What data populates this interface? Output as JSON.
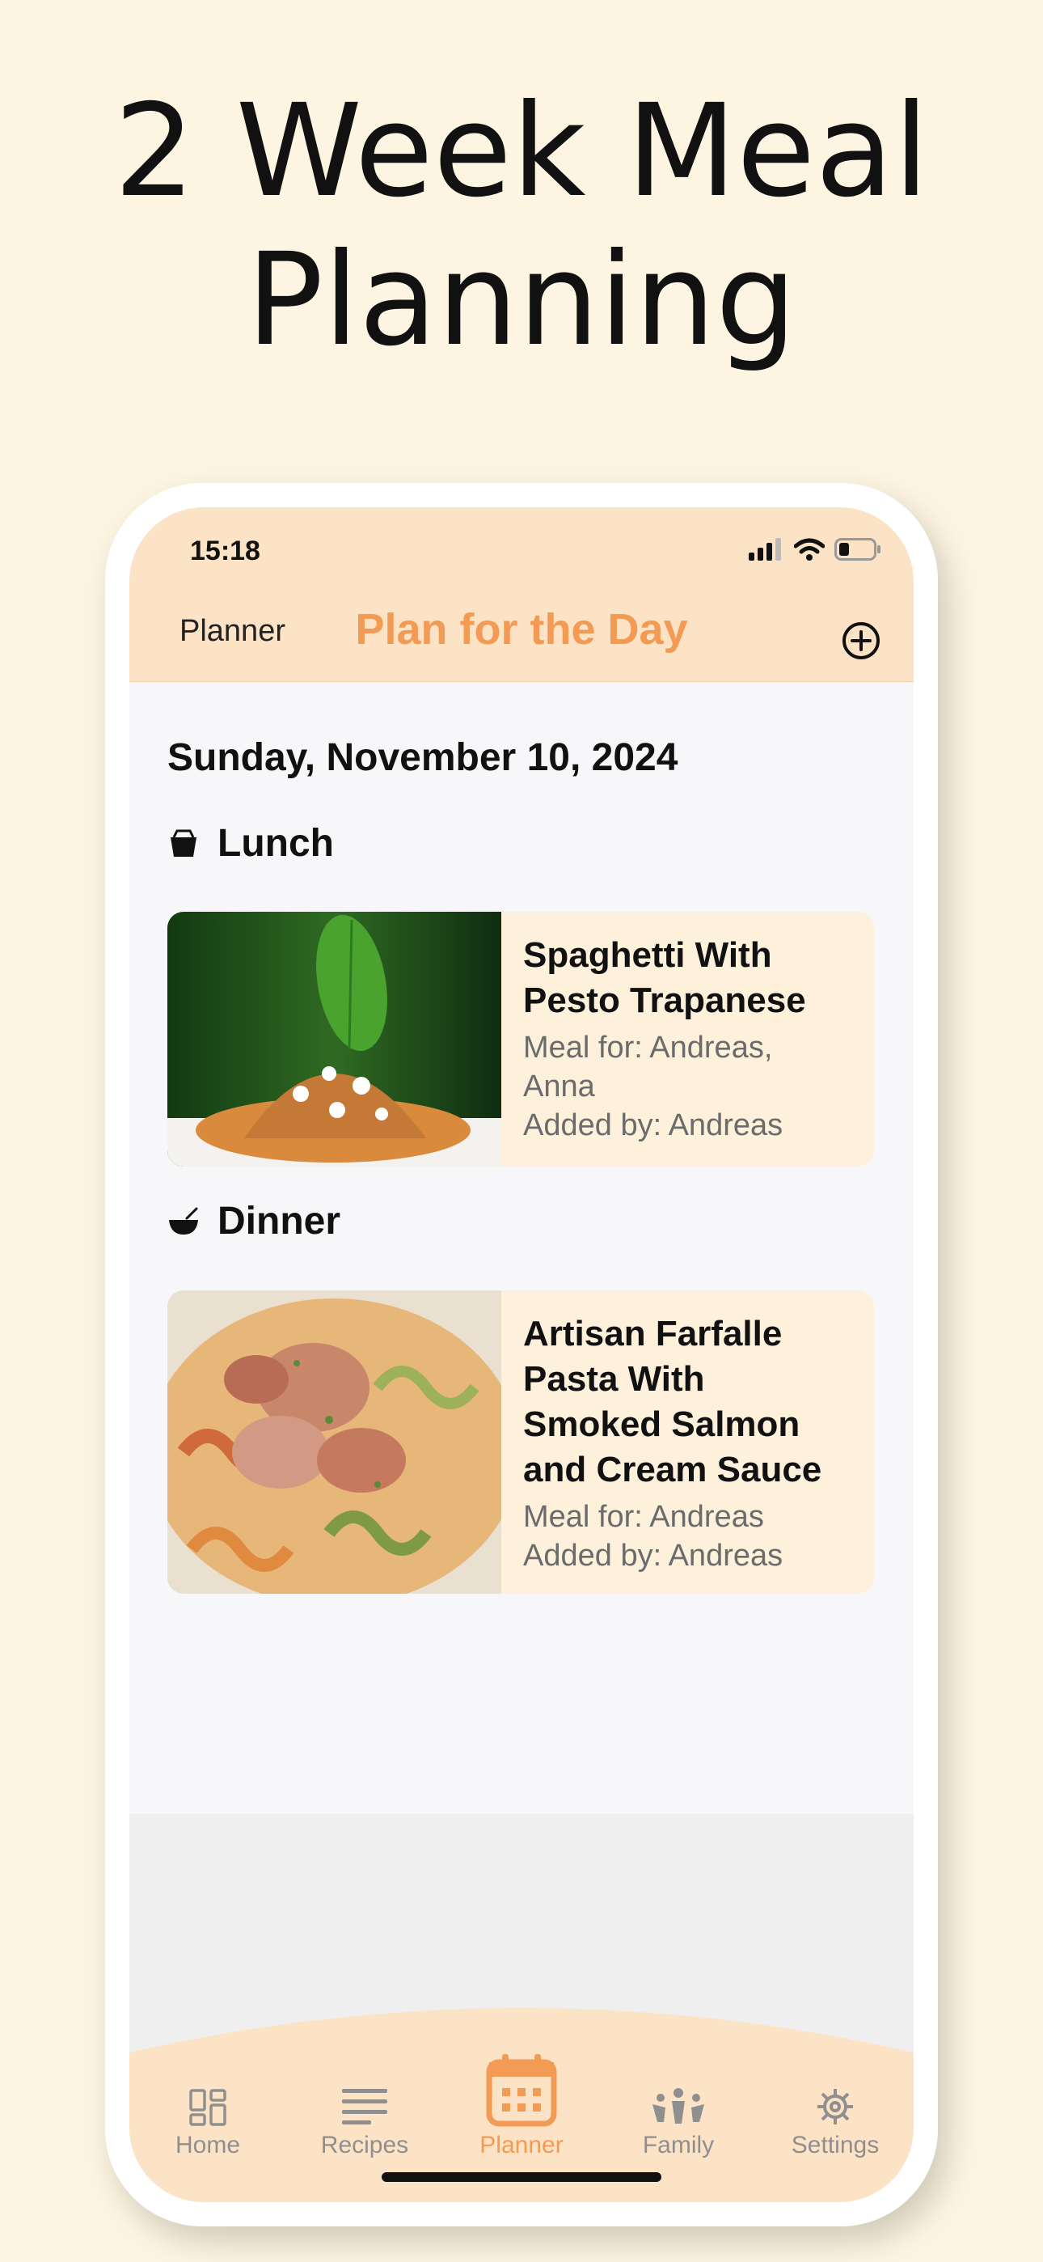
{
  "headline": {
    "line1": "2 Week Meal",
    "line2": "Planning"
  },
  "status": {
    "time": "15:18"
  },
  "nav": {
    "back_label": "Planner",
    "title": "Plan for the Day",
    "add_icon": "plus-circle-icon"
  },
  "planner": {
    "date": "Sunday, November 10, 2024",
    "sections": [
      {
        "title": "Lunch",
        "icon": "takeout-box-icon",
        "meal": {
          "name_lines": [
            "Spaghetti With",
            "Pesto Trapanese"
          ],
          "meal_for_lines": [
            "Meal for: Andreas,",
            "Anna"
          ],
          "added_by": "Added by: Andreas"
        }
      },
      {
        "title": "Dinner",
        "icon": "bowl-icon",
        "meal": {
          "name_lines": [
            "Artisan Farfalle",
            "Pasta With",
            "Smoked Salmon",
            "and Cream Sauce"
          ],
          "meal_for_lines": [
            "Meal for: Andreas"
          ],
          "added_by": "Added by: Andreas"
        }
      }
    ]
  },
  "tabbar": {
    "items": [
      {
        "label": "Home",
        "icon": "grid-icon",
        "active": false
      },
      {
        "label": "Recipes",
        "icon": "list-icon",
        "active": false
      },
      {
        "label": "Planner",
        "icon": "calendar-icon",
        "active": true
      },
      {
        "label": "Family",
        "icon": "people-icon",
        "active": false
      },
      {
        "label": "Settings",
        "icon": "gear-icon",
        "active": false
      }
    ]
  },
  "colors": {
    "accent": "#f39a55",
    "header_bg": "#fde3c5",
    "card_bg": "#fdf1dc",
    "page_bg": "#fdf5e1"
  }
}
